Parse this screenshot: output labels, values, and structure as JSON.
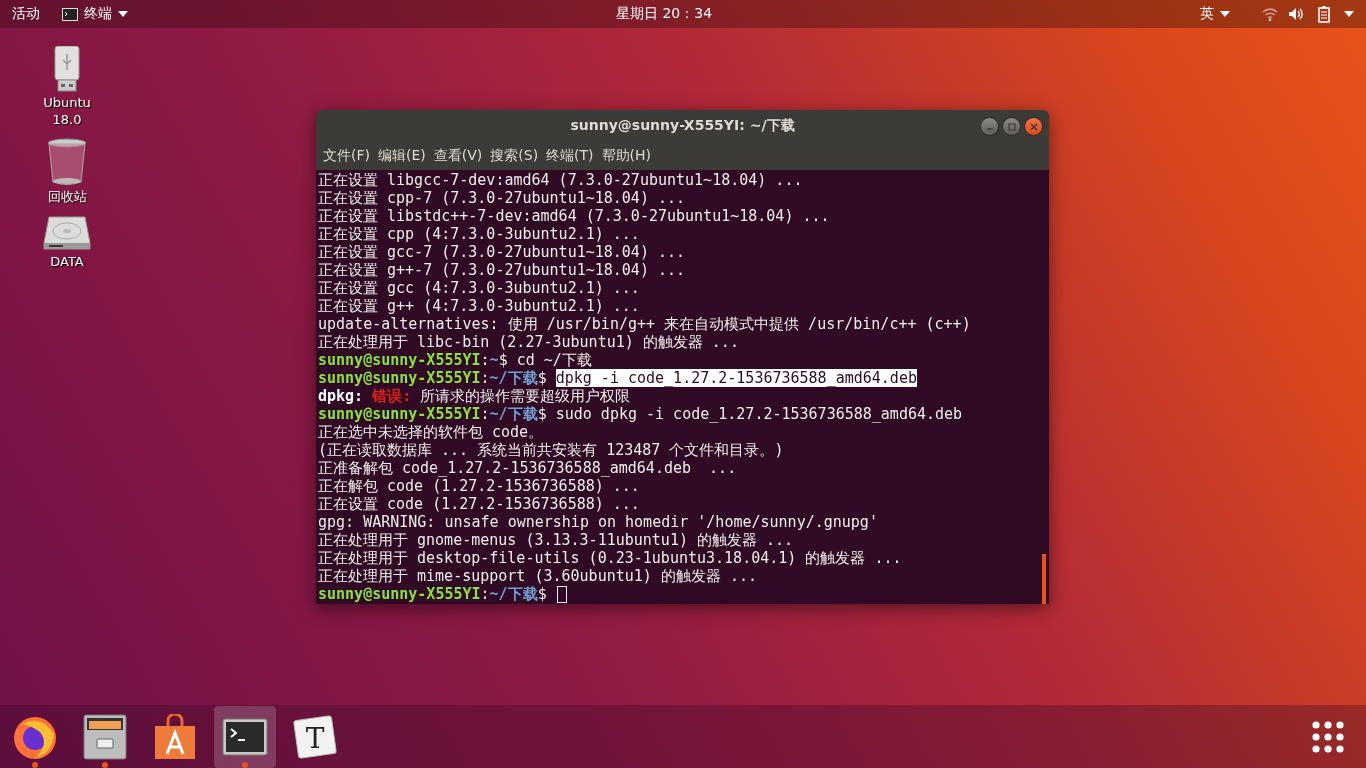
{
  "top_bar": {
    "activities": "活动",
    "app_menu": "终端",
    "clock": "星期日 20：34",
    "input_method": "英"
  },
  "desktop_icons": [
    {
      "kind": "usb",
      "label": "Ubuntu 18.0"
    },
    {
      "kind": "trash",
      "label": "回收站"
    },
    {
      "kind": "disk",
      "label": "DATA"
    }
  ],
  "terminal": {
    "title": "sunny@sunny-X555YI: ~/下载",
    "menu": [
      "文件(F)",
      "编辑(E)",
      "查看(V)",
      "搜索(S)",
      "终端(T)",
      "帮助(H)"
    ],
    "lines": [
      [
        {
          "kind": "text",
          "text": "正在设置 libgcc-7-dev:amd64 (7.3.0-27ubuntu1~18.04) ..."
        }
      ],
      [
        {
          "kind": "text",
          "text": "正在设置 cpp-7 (7.3.0-27ubuntu1~18.04) ..."
        }
      ],
      [
        {
          "kind": "text",
          "text": "正在设置 libstdc++-7-dev:amd64 (7.3.0-27ubuntu1~18.04) ..."
        }
      ],
      [
        {
          "kind": "text",
          "text": "正在设置 cpp (4:7.3.0-3ubuntu2.1) ..."
        }
      ],
      [
        {
          "kind": "text",
          "text": "正在设置 gcc-7 (7.3.0-27ubuntu1~18.04) ..."
        }
      ],
      [
        {
          "kind": "text",
          "text": "正在设置 g++-7 (7.3.0-27ubuntu1~18.04) ..."
        }
      ],
      [
        {
          "kind": "text",
          "text": "正在设置 gcc (4:7.3.0-3ubuntu2.1) ..."
        }
      ],
      [
        {
          "kind": "text",
          "text": "正在设置 g++ (4:7.3.0-3ubuntu2.1) ..."
        }
      ],
      [
        {
          "kind": "text",
          "text": "update-alternatives: 使用 /usr/bin/g++ 来在自动模式中提供 /usr/bin/c++ (c++)"
        }
      ],
      [
        {
          "kind": "text",
          "text": "正在处理用于 libc-bin (2.27-3ubuntu1) 的触发器 ..."
        }
      ],
      [
        {
          "kind": "user",
          "text": "sunny@sunny-X555YI"
        },
        {
          "kind": "text",
          "text": ":"
        },
        {
          "kind": "path",
          "text": "~"
        },
        {
          "kind": "text",
          "text": "$ cd ~/下载"
        }
      ],
      [
        {
          "kind": "user",
          "text": "sunny@sunny-X555YI"
        },
        {
          "kind": "text",
          "text": ":"
        },
        {
          "kind": "path",
          "text": "~/下载"
        },
        {
          "kind": "text",
          "text": "$ "
        },
        {
          "kind": "selected",
          "text": "dpkg -i code_1.27.2-1536736588_amd64.deb"
        }
      ],
      [
        {
          "kind": "bold",
          "text": "dpkg: "
        },
        {
          "kind": "error",
          "text": "错误: "
        },
        {
          "kind": "text",
          "text": "所请求的操作需要超级用户权限"
        }
      ],
      [
        {
          "kind": "user",
          "text": "sunny@sunny-X555YI"
        },
        {
          "kind": "text",
          "text": ":"
        },
        {
          "kind": "path",
          "text": "~/下载"
        },
        {
          "kind": "text",
          "text": "$ sudo dpkg -i code_1.27.2-1536736588_amd64.deb"
        }
      ],
      [
        {
          "kind": "text",
          "text": "正在选中未选择的软件包 code。"
        }
      ],
      [
        {
          "kind": "text",
          "text": "(正在读取数据库 ... 系统当前共安装有 123487 个文件和目录。)"
        }
      ],
      [
        {
          "kind": "text",
          "text": "正准备解包 code_1.27.2-1536736588_amd64.deb  ..."
        }
      ],
      [
        {
          "kind": "text",
          "text": "正在解包 code (1.27.2-1536736588) ..."
        }
      ],
      [
        {
          "kind": "text",
          "text": "正在设置 code (1.27.2-1536736588) ..."
        }
      ],
      [
        {
          "kind": "text",
          "text": "gpg: WARNING: unsafe ownership on homedir '/home/sunny/.gnupg'"
        }
      ],
      [
        {
          "kind": "text",
          "text": "正在处理用于 gnome-menus (3.13.3-11ubuntu1) 的触发器 ..."
        }
      ],
      [
        {
          "kind": "text",
          "text": "正在处理用于 desktop-file-utils (0.23-1ubuntu3.18.04.1) 的触发器 ..."
        }
      ],
      [
        {
          "kind": "text",
          "text": "正在处理用于 mime-support (3.60ubuntu1) 的触发器 ..."
        }
      ],
      [
        {
          "kind": "user",
          "text": "sunny@sunny-X555YI"
        },
        {
          "kind": "text",
          "text": ":"
        },
        {
          "kind": "path",
          "text": "~/下载"
        },
        {
          "kind": "text",
          "text": "$ "
        }
      ]
    ],
    "cursor": true
  },
  "dock": [
    {
      "kind": "firefox",
      "running": true,
      "selected": false
    },
    {
      "kind": "files",
      "running": true,
      "selected": false
    },
    {
      "kind": "software",
      "running": false,
      "selected": false
    },
    {
      "kind": "terminal",
      "running": true,
      "selected": true
    },
    {
      "kind": "typora",
      "glyph": "T",
      "running": false,
      "selected": false
    }
  ]
}
